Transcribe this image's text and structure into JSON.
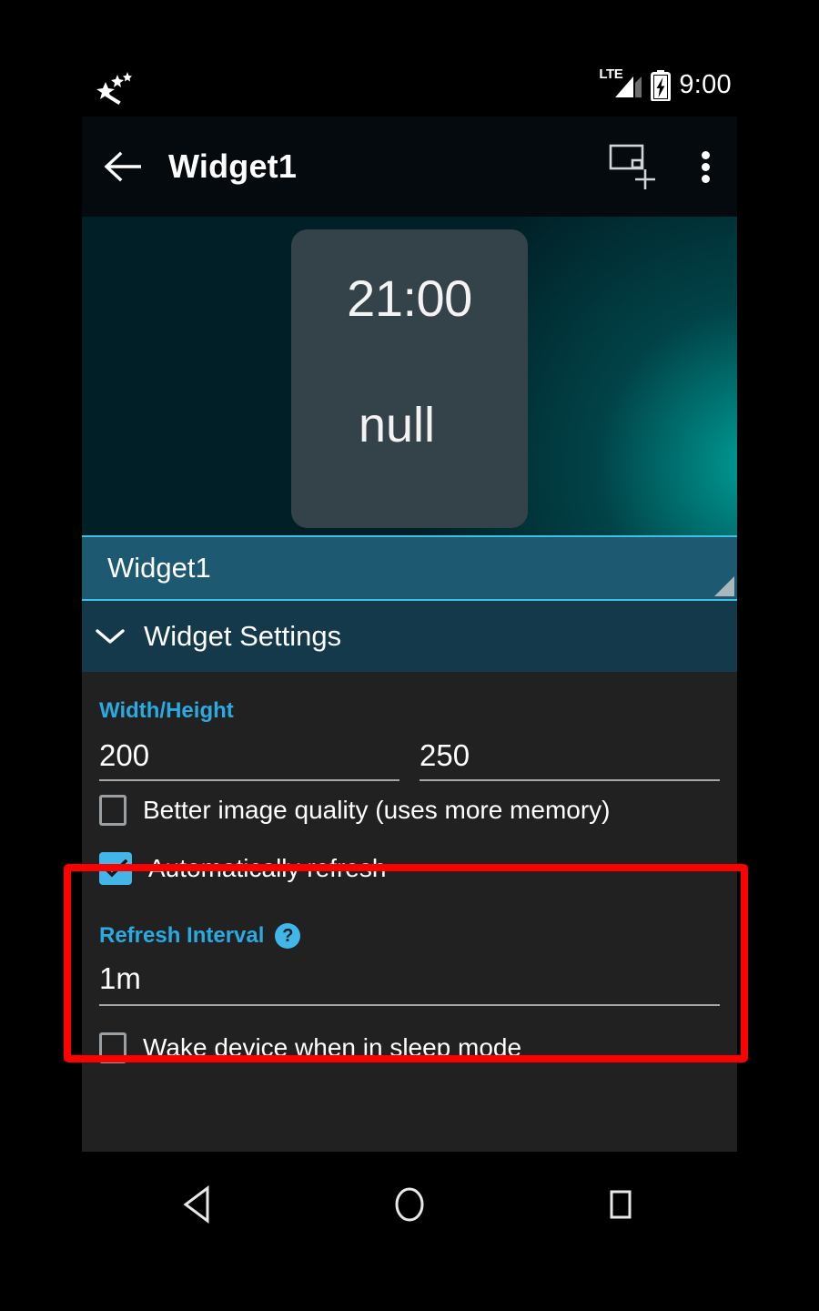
{
  "status_bar": {
    "left_icon": "magic-wand-icon",
    "network_label": "LTE",
    "signal_icon": "signal-bars-icon",
    "battery_icon": "battery-charging-icon",
    "clock": "9:00"
  },
  "app_bar": {
    "back_icon": "back-arrow-icon",
    "title": "Widget1",
    "add_widget_icon": "add-widget-icon",
    "overflow_icon": "overflow-menu-icon"
  },
  "widget_preview": {
    "time": "21:00",
    "subtext": "null",
    "card_color": "#344349",
    "background_color": "#011f26",
    "glow_color": "#00beb4"
  },
  "widget_select_bar": {
    "label": "Widget1",
    "resize_handle_icon": "resize-handle-icon",
    "background_color": "#1d5a71",
    "border_color": "#3fc0e0"
  },
  "widget_settings": {
    "chevron_icon": "chevron-down-icon",
    "title": "Widget Settings",
    "background_color": "#14394a"
  },
  "settings": {
    "accent_color": "#2aaae2",
    "dimensions": {
      "label": "Width/Height",
      "width_value": "200",
      "height_value": "250"
    },
    "better_image_quality": {
      "label": "Better image quality (uses more memory)",
      "checked": "false"
    },
    "automatically_refresh": {
      "label": "Automatically refresh",
      "checked": "true"
    },
    "refresh_interval": {
      "label": "Refresh Interval",
      "help_icon": "help-icon",
      "help_glyph": "?",
      "value": "1m"
    },
    "wake_device": {
      "label": "Wake device when in sleep mode",
      "checked": "false"
    }
  },
  "highlight": {
    "color": "#ff0000"
  },
  "nav_bar": {
    "back_icon": "nav-back-icon",
    "home_icon": "nav-home-icon",
    "recents_icon": "nav-recents-icon"
  }
}
